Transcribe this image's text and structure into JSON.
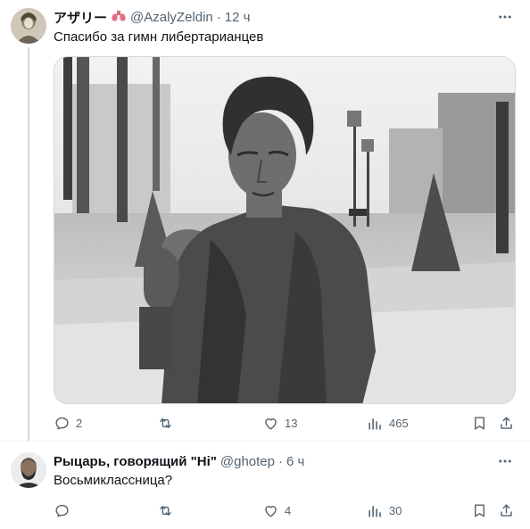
{
  "tweets": [
    {
      "display_name": "アザリー",
      "handle": "@AzalyZeldin",
      "separator": "·",
      "time": "12 ч",
      "text": "Спасибо за гимн либертарианцев",
      "badge_icon": "lungs-icon",
      "media_description_icon": "statue-photo",
      "stats": {
        "replies": "2",
        "retweets": "",
        "likes": "13",
        "views": "465"
      }
    },
    {
      "display_name": "Рыцарь, говорящий \"Hi\"",
      "handle": "@ghotep",
      "separator": "·",
      "time": "6 ч",
      "text": "Восьмиклассница?",
      "stats": {
        "replies": "",
        "retweets": "",
        "likes": "4",
        "views": "30"
      }
    }
  ],
  "colors": {
    "text": "#0f1419",
    "secondary": "#536471",
    "border": "#cfd9de"
  }
}
